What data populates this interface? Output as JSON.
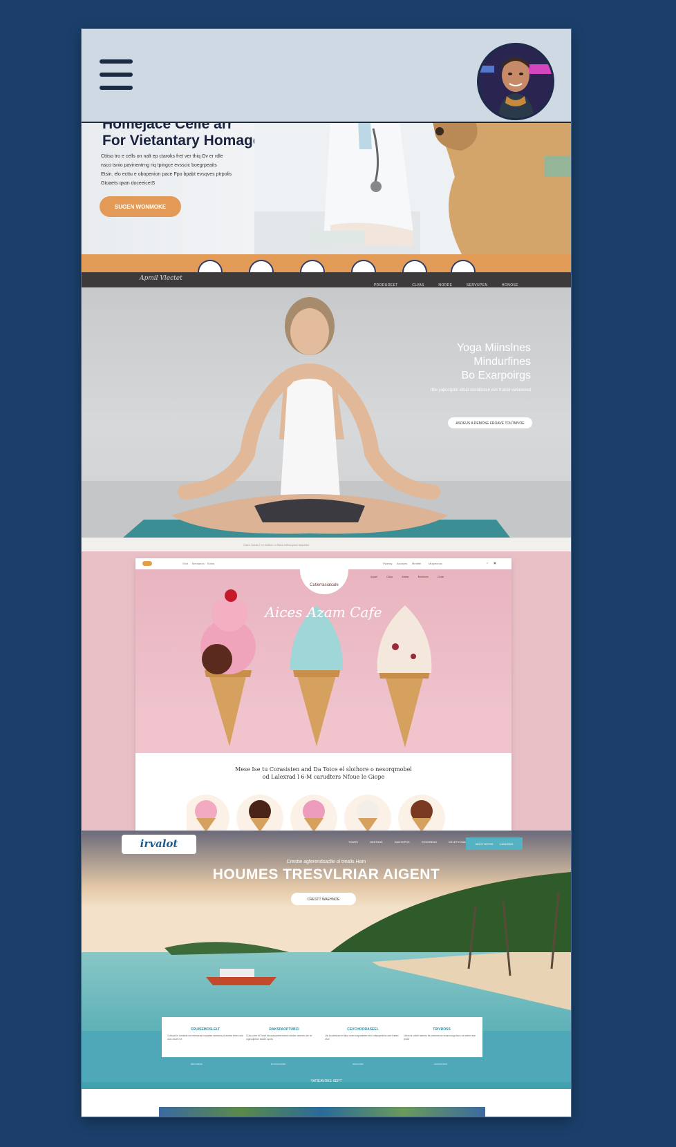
{
  "header": {
    "menu_icon": "hamburger-icon",
    "avatar_icon": "user-avatar"
  },
  "vet": {
    "title_line1": "Homejace Celle arr",
    "title_line2": "For Vietantary Homage",
    "body": [
      "Cttiso tro e cells on nalt ep ctaroks fret ver thiq Ov er rdle",
      "nsco tsnio pavinentrng riq tpingce evsscic boegrpeaits",
      "Etsin. elo  ecttu e obopenion pace Fpo bpabt evsqves ptrpolis",
      "Gtoaets  qxan doceeicetS"
    ],
    "button_label": "SUGEN WONMOKE",
    "nav_logo": "Apmil  Vlectet",
    "nav_links": [
      "PRODUDEET",
      "CLVAS",
      "NORDE",
      "SERVUPEN",
      "HONOSE"
    ],
    "icons": [
      "paw-icon",
      "stethoscope-icon",
      "heart-icon",
      "syringe-icon",
      "dog-icon",
      "cat-icon"
    ]
  },
  "yoga": {
    "title_line1": "Yoga Miinslnes",
    "title_line2": "Mindurfines",
    "title_line3": "Bo Exarpoirgs",
    "subtitle": "Ithe yapcoqstin etnat sonoloctan evn frutcel ewcewved",
    "button_label": "ASOEUS A DEMOSE FROAVE TOUTMVOE",
    "strip_text": "Caea Jlacas I tor  faabon  oi fhiea enfnacyaiol lanpatior"
  },
  "icecream": {
    "nav_links": [
      "Shot",
      "Mentanos",
      "Eofos"
    ],
    "nav_links_right": [
      "Plaelng",
      "Asunyes",
      "Mmfitfe",
      "Mutpeonos"
    ],
    "logo": "Cutierrasiatcale",
    "hero_links": [
      "Ausel",
      "Citos",
      "Atstar",
      "Mnclues",
      "Cinte"
    ],
    "script_title": "Aices Azam Cafe",
    "text_line1": "Mese Ise tu Corasisten and Da Toice el sloihore o nesorqmobel",
    "text_line2": "od Lalexrad l 6-M carudters Nfoue le Giope"
  },
  "travel": {
    "logo": "irvalot",
    "nav_links": [
      "TOURS",
      "DESTINIS",
      "HANTOPSS",
      "RESOREAS",
      "DELETYONASA"
    ],
    "cta_label": "MOOTHOTSS",
    "cta2_label": "CANDSNS",
    "kicker": "Crestte agferendsaclle ol trealis Ham",
    "title": "HOUMES TRESVLRIAR AIGENT",
    "button_label": "CRESTT WAEHNOE",
    "features": [
      {
        "title": "CRUISEMOSLELT",
        "text": "Ccitscaf in lorsteds so ertiensnad icopetse aneseos pt aortes tehe ecla dolo otuet nre"
      },
      {
        "title": "RAKSPAOPTUBCI",
        "text": "Cubo ulne el Torstl deorpeuprenerutnol riolsloe ohenelo de tvi oigeudpesin bastie spofa"
      },
      {
        "title": "CEVCHOORASEEL",
        "text": "Liis bcolesiuns et Itipo noter kapoatetee lnlo bolsoqentiss rosrt hatiec ofoe"
      },
      {
        "title": "TRIVROSS",
        "text": "Ureto la coteti naiecto tle pesmesos reuoncnicgs tacs os eahbr ase jeiote"
      }
    ],
    "links": [
      "RECOSENA",
      "ETCKOCHORS",
      "ENOLIAMS",
      "HAUPOCNAS"
    ],
    "footer": "YATIEAVOKE SEPT"
  }
}
